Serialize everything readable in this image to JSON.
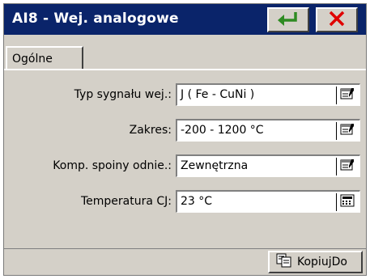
{
  "window": {
    "title": "AI8 - Wej. analogowe",
    "buttons": [
      {
        "name": "enter",
        "icon": "enter-arrow-icon",
        "color": "#2e8b22"
      },
      {
        "name": "close",
        "icon": "close-icon",
        "color": "#e00000"
      }
    ]
  },
  "tabs": [
    {
      "label": "Ogólne",
      "active": true
    }
  ],
  "fields": [
    {
      "label": "Typ sygnału wej.:",
      "value": "J ( Fe - CuNi )",
      "button_icon": "properties-icon"
    },
    {
      "label": "Zakres:",
      "value": "-200 - 1200 °C",
      "button_icon": "properties-icon"
    },
    {
      "label": "Komp. spoiny odnie.:",
      "value": "Zewnętrzna",
      "button_icon": "properties-icon"
    },
    {
      "label": "Temperatura CJ:",
      "value": "23 °C",
      "button_icon": "keypad-icon"
    }
  ],
  "footer": {
    "copy_label": "KopiujDo",
    "copy_icon": "copy-icon"
  },
  "colors": {
    "titlebar": "#0a246a",
    "face": "#d4d0c8"
  }
}
